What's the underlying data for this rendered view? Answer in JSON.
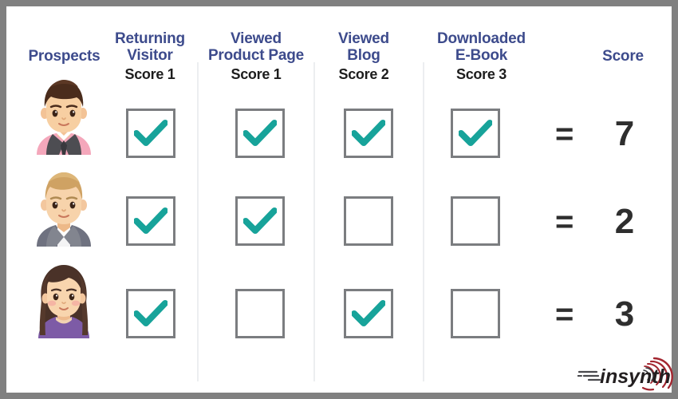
{
  "frame": {
    "border_color": "#808080",
    "background": "#ffffff"
  },
  "theme": {
    "header_text_color": "#3d4b8c",
    "score_label_color": "#1d1d1d",
    "check_color": "#17a39a",
    "checkbox_border_color": "#7b7d80",
    "divider_color": "#eceef0",
    "logo_accent_color": "#a32630",
    "logo_text_color": "#231f20"
  },
  "columns": [
    {
      "id": "prospects",
      "title": "Prospects",
      "score_label": ""
    },
    {
      "id": "returning",
      "title": "Returning\nVisitor",
      "score_label": "Score 1"
    },
    {
      "id": "product",
      "title": "Viewed\nProduct Page",
      "score_label": "Score 1"
    },
    {
      "id": "blog",
      "title": "Viewed\nBlog",
      "score_label": "Score 2"
    },
    {
      "id": "ebook",
      "title": "Downloaded\nE-Book",
      "score_label": "Score 3"
    },
    {
      "id": "score",
      "title": "Score",
      "score_label": ""
    }
  ],
  "equals_symbol": "=",
  "rows": [
    {
      "avatar": "avatar-man-pink-shirt",
      "checks": [
        true,
        true,
        true,
        true
      ],
      "equals": "=",
      "score": "7"
    },
    {
      "avatar": "avatar-man-grey-suit",
      "checks": [
        true,
        true,
        false,
        false
      ],
      "equals": "=",
      "score": "2"
    },
    {
      "avatar": "avatar-woman-purple-top",
      "checks": [
        true,
        false,
        true,
        false
      ],
      "equals": "=",
      "score": "3"
    }
  ],
  "logo": {
    "name": "insynth-logo",
    "text": "insynth"
  }
}
